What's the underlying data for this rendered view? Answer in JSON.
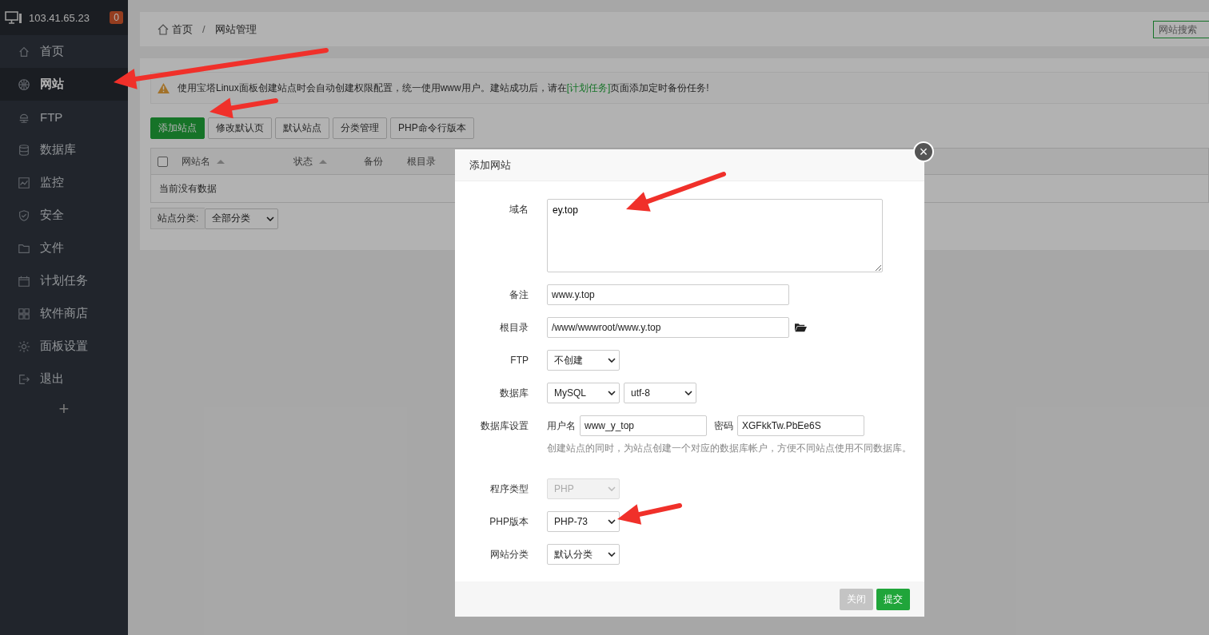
{
  "server": {
    "ip": "103.41.65.23",
    "badge": "0"
  },
  "sidebar": {
    "items": [
      {
        "label": "首页",
        "selected": false
      },
      {
        "label": "网站",
        "selected": true
      },
      {
        "label": "FTP",
        "selected": false
      },
      {
        "label": "数据库",
        "selected": false
      },
      {
        "label": "监控",
        "selected": false
      },
      {
        "label": "安全",
        "selected": false
      },
      {
        "label": "文件",
        "selected": false
      },
      {
        "label": "计划任务",
        "selected": false
      },
      {
        "label": "软件商店",
        "selected": false
      },
      {
        "label": "面板设置",
        "selected": false
      },
      {
        "label": "退出",
        "selected": false
      }
    ],
    "add_button": "+"
  },
  "breadcrumb": [
    "首页",
    "/",
    "网站管理"
  ],
  "search": {
    "placeholder": "网站搜索"
  },
  "notice": {
    "before": "使用宝塔Linux面板创建站点时会自动创建权限配置，统一使用www用户。建站成功后，请在",
    "link": "[计划任务]",
    "after": "页面添加定时备份任务!"
  },
  "toolbar": [
    {
      "label": "添加站点",
      "primary": true
    },
    {
      "label": "修改默认页",
      "primary": false
    },
    {
      "label": "默认站点",
      "primary": false
    },
    {
      "label": "分类管理",
      "primary": false
    },
    {
      "label": "PHP命令行版本",
      "primary": false
    }
  ],
  "table": {
    "checked": false,
    "columns": [
      {
        "label": "网站名",
        "sortable": true
      },
      {
        "label": "状态",
        "sortable": true
      },
      {
        "label": "备份",
        "sortable": false
      },
      {
        "label": "根目录",
        "sortable": false
      }
    ],
    "empty": "当前没有数据"
  },
  "category_filter": {
    "label": "站点分类:",
    "value": "全部分类"
  },
  "dialog": {
    "title": "添加网站",
    "close": "×",
    "domain": {
      "label": "域名",
      "value": "ey.top"
    },
    "remark": {
      "label": "备注",
      "value": "www.y.top"
    },
    "root": {
      "label": "根目录",
      "value": "/www/wwwroot/www.y.top"
    },
    "ftp": {
      "label": "FTP",
      "value": "不创建"
    },
    "database": {
      "label": "数据库",
      "value": "MySQL",
      "charset": "utf-8"
    },
    "db_settings": {
      "label": "数据库设置",
      "user_label": "用户名",
      "user": "www_y_top",
      "password_label": "密码",
      "password": "XGFkkTw.PbEe6S",
      "hint": "创建站点的同时，为站点创建一个对应的数据库帐户，方便不同站点使用不同数据库。"
    },
    "program_type": {
      "label": "程序类型",
      "value": "PHP",
      "disabled": true
    },
    "php_version": {
      "label": "PHP版本",
      "value": "PHP-73",
      "disabled": false
    },
    "site_category": {
      "label": "网站分类",
      "value": "默认分类"
    },
    "buttons": [
      {
        "label": "关闭",
        "primary": false
      },
      {
        "label": "提交",
        "primary": true
      }
    ]
  }
}
